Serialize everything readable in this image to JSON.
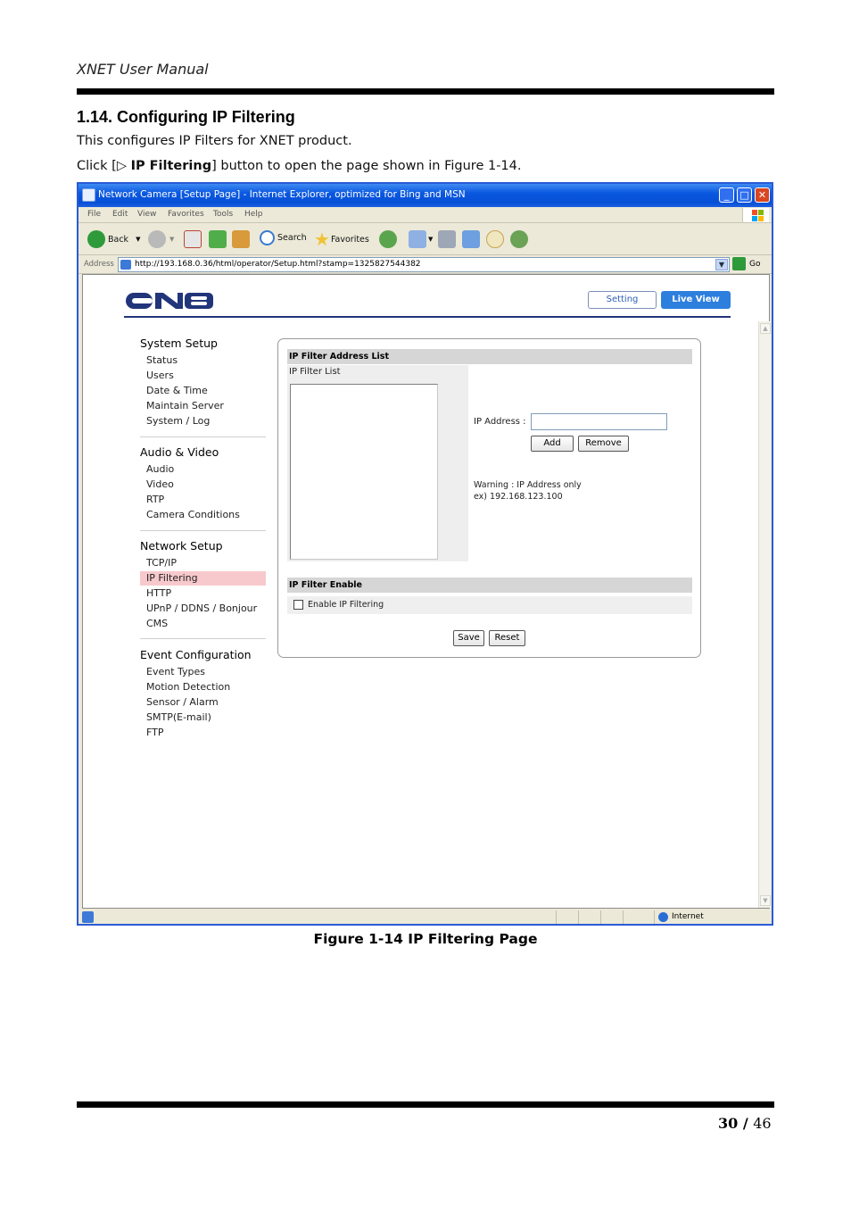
{
  "document": {
    "header": "XNET User Manual",
    "section_title": "1.14. Configuring IP Filtering",
    "intro": "This configures IP Filters for XNET product.",
    "instruction_prefix": "Click [▷ ",
    "instruction_bold": "IP Filtering",
    "instruction_suffix": "] button to open the page shown in Figure 1-14.",
    "caption": "Figure 1-14 IP Filtering Page",
    "page_current": "30",
    "page_separator": " / ",
    "page_total": "46"
  },
  "browser": {
    "title": "Network Camera [Setup Page] - Internet Explorer, optimized for Bing and MSN",
    "menu": [
      "File",
      "Edit",
      "View",
      "Favorites",
      "Tools",
      "Help"
    ],
    "toolbar": {
      "back": "Back",
      "search": "Search",
      "favorites": "Favorites"
    },
    "address_label": "Address",
    "url": "http://193.168.0.36/html/operator/Setup.html?stamp=1325827544382",
    "go": "Go",
    "status_zone": "Internet"
  },
  "camera_ui": {
    "setting_button": "Setting",
    "live_view_button": "Live View",
    "nav": {
      "system_setup": {
        "title": "System Setup",
        "items": [
          "Status",
          "Users",
          "Date & Time",
          "Maintain Server",
          "System / Log"
        ]
      },
      "audio_video": {
        "title": "Audio & Video",
        "items": [
          "Audio",
          "Video",
          "RTP",
          "Camera Conditions"
        ]
      },
      "network_setup": {
        "title": "Network Setup",
        "items": [
          "TCP/IP",
          "IP Filtering",
          "HTTP",
          "UPnP / DDNS / Bonjour",
          "CMS"
        ]
      },
      "event_configuration": {
        "title": "Event Configuration",
        "items": [
          "Event Types",
          "Motion Detection",
          "Sensor / Alarm",
          "SMTP(E-mail)",
          "FTP"
        ]
      }
    },
    "panel": {
      "address_list_header": "IP Filter Address List",
      "filter_list_label": "IP Filter List",
      "ip_address_label": "IP Address :",
      "ip_address_value": "",
      "add_button": "Add",
      "remove_button": "Remove",
      "warning": "Warning : IP Address only",
      "example": "ex) 192.168.123.100",
      "enable_header": "IP Filter Enable",
      "enable_label": "Enable IP Filtering",
      "enable_checked": false,
      "save_button": "Save",
      "reset_button": "Reset"
    },
    "colors": {
      "accent": "#2d7fde",
      "active_nav": "#f7c9cc",
      "logo": "#22357a"
    }
  }
}
